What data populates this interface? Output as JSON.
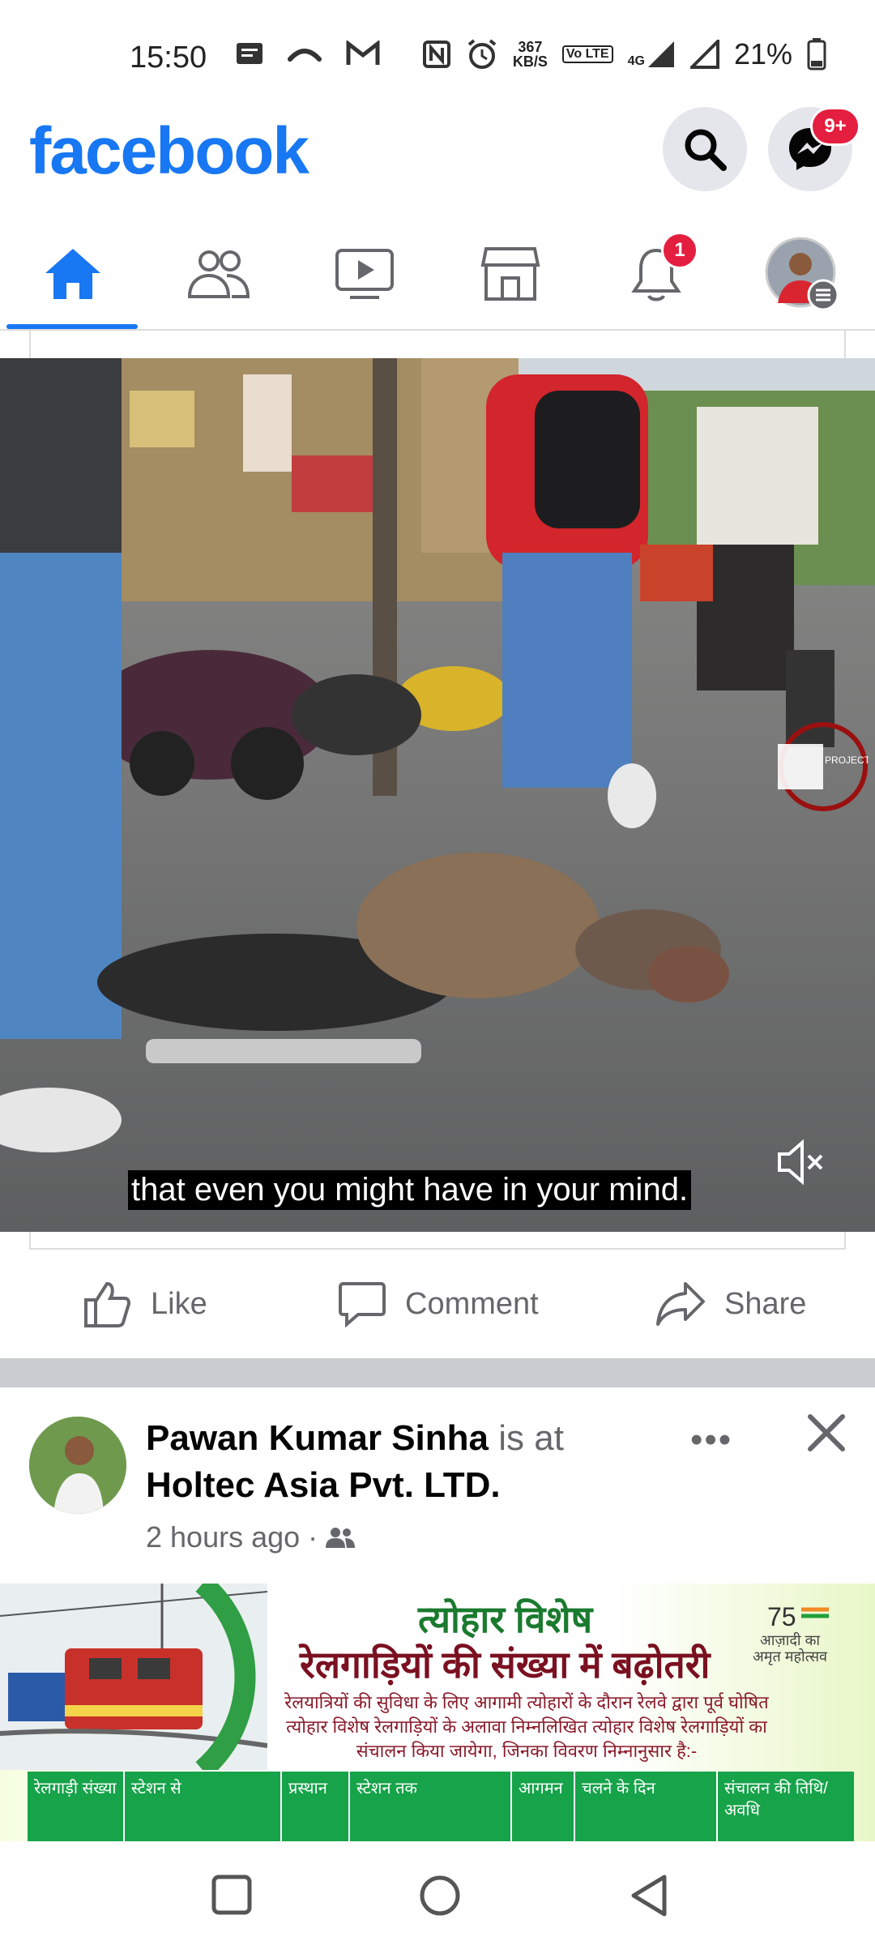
{
  "status_bar": {
    "time": "15:50",
    "net_speed_value": "367",
    "net_speed_unit": "KB/S",
    "lte_label": "Vo LTE",
    "network_type": "4G",
    "battery": "21%"
  },
  "header": {
    "logo": "facebook",
    "messenger_badge": "9+"
  },
  "tabs": {
    "notifications_badge": "1"
  },
  "video": {
    "caption": "that even you might have in your mind.",
    "watermark": "PROJECT NIGHTFALL"
  },
  "actions": {
    "like": "Like",
    "comment": "Comment",
    "share": "Share"
  },
  "post2": {
    "author": "Pawan Kumar Sinha",
    "is_at": " is at",
    "place": "Holtec Asia Pvt. LTD.",
    "time": "2 hours ago ·",
    "more": "•••"
  },
  "banner": {
    "title": "त्योहार विशेष",
    "subtitle": "रेलगाड़ियों की संख्या में बढ़ोतरी",
    "text": "रेलयात्रियों की सुविधा के लिए आगामी त्योहारों के दौरान रेलवे द्वारा पूर्व घोषित त्योहार विशेष रेलगाड़ियों के अलावा निम्नलिखित त्योहार विशेष रेलगाड़ियों का संचालन किया जायेगा, जिनका विवरण निम्नानुसार है:-",
    "logo_text": "आज़ादी का अमृत महोत्सव",
    "table_headers": [
      "रेलगाड़ी संख्या",
      "स्टेशन से",
      "प्रस्थान",
      "स्टेशन तक",
      "आगमन",
      "चलने के दिन",
      "संचालन की तिथि/अवधि"
    ]
  }
}
